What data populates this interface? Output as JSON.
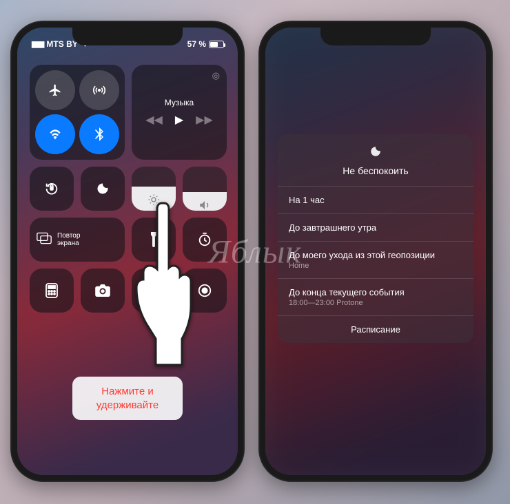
{
  "status": {
    "carrier": "MTS BY",
    "battery_pct": "57 %"
  },
  "music": {
    "label": "Музыка"
  },
  "mirror": {
    "label_line1": "Повтор",
    "label_line2": "экрана"
  },
  "callout": {
    "line1": "Нажмите и",
    "line2": "удерживайте"
  },
  "dnd": {
    "title": "Не беспокоить",
    "options": [
      {
        "label": "На 1 час"
      },
      {
        "label": "До завтрашнего утра"
      },
      {
        "label": "До моего ухода из этой геопозиции",
        "sub": "Home"
      },
      {
        "label": "До конца текущего события",
        "sub": "18:00—23:00 Protone"
      }
    ],
    "schedule": "Расписание"
  },
  "watermark": "Яблык"
}
